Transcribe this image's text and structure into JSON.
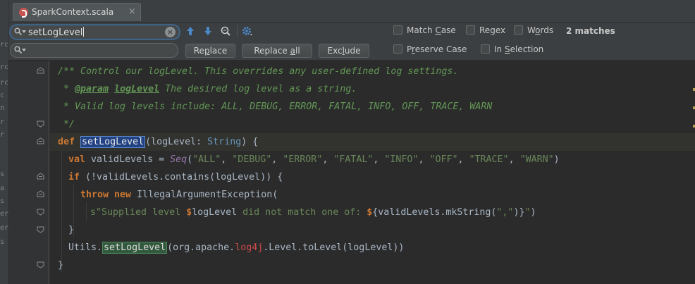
{
  "left_strip_fragments": [
    "rc",
    "rc",
    "rc",
    "c",
    "n",
    "r",
    "r",
    "s",
    "a",
    "s",
    "er",
    "er",
    "s"
  ],
  "tab": {
    "title": "SparkContext.scala",
    "close": "×"
  },
  "find": {
    "search_value": "setLogLevel",
    "replace_value": "",
    "replace_button": {
      "pre": "Re",
      "u": "p",
      "post": "lace"
    },
    "replace_all_button": {
      "pre": "Replace ",
      "u": "a",
      "post": "ll"
    },
    "exclude_button": {
      "pre": "Exc",
      "u": "l",
      "post": "ude"
    },
    "match_case": {
      "pre": "Match ",
      "u": "C",
      "post": "ase"
    },
    "regex": {
      "pre": "Re",
      "u": "g",
      "post": "ex"
    },
    "words": {
      "pre": "W",
      "u": "o",
      "post": "rds"
    },
    "preserve_case": {
      "pre": "P",
      "u": "r",
      "post": "eserve Case"
    },
    "in_selection": {
      "pre": "In ",
      "u": "S",
      "post": "election"
    },
    "matches": "2 matches"
  },
  "code": {
    "l1": "/** Control our logLevel. This overrides any user-defined log settings.",
    "l2_a": " * ",
    "l2_tag": "@param",
    "l2_sp": " ",
    "l2_param": "logLevel",
    "l2_b": " The desired log level as a string.",
    "l3": " * Valid log levels include: ALL, DEBUG, ERROR, FATAL, INFO, OFF, TRACE, WARN",
    "l4": " */",
    "l5_kw": "def",
    "l5_sp": " ",
    "l5_name": "setLogLevel",
    "l5_a": "(logLevel: ",
    "l5_type": "String",
    "l5_b": ") {",
    "l6_kw": "val",
    "l6_a": " validLevels = ",
    "l6_seq": "Seq",
    "l6_p": "(",
    "l6_s1": "\"ALL\"",
    "l6_s2": "\"DEBUG\"",
    "l6_s3": "\"ERROR\"",
    "l6_s4": "\"FATAL\"",
    "l6_s5": "\"INFO\"",
    "l6_s6": "\"OFF\"",
    "l6_s7": "\"TRACE\"",
    "l6_s8": "\"WARN\"",
    "l6_comma": ", ",
    "l6_end": ")",
    "l7_kw": "if",
    "l7_a": " (!validLevels.contains(logLevel)) {",
    "l8_kw1": "throw",
    "l8_sp": " ",
    "l8_kw2": "new",
    "l8_a": " IllegalArgumentException(",
    "l9_s": "s\"Supplied level ",
    "l9_d1": "$",
    "l9_v": "logLevel",
    "l9_s2": " did not match one of: ",
    "l9_d2": "$",
    "l9_b": "{validLevels.mkString(",
    "l9_s3": "\",\"",
    "l9_c": ")}",
    "l9_s4": "\"",
    "l9_e": ")",
    "l10": "}",
    "l11_a": "Utils.",
    "l11_m": "setLogLevel",
    "l11_b": "(org.apache.",
    "l11_log": "log4j",
    "l11_c": ".Level.toLevel(logLevel))",
    "l12": "}"
  }
}
